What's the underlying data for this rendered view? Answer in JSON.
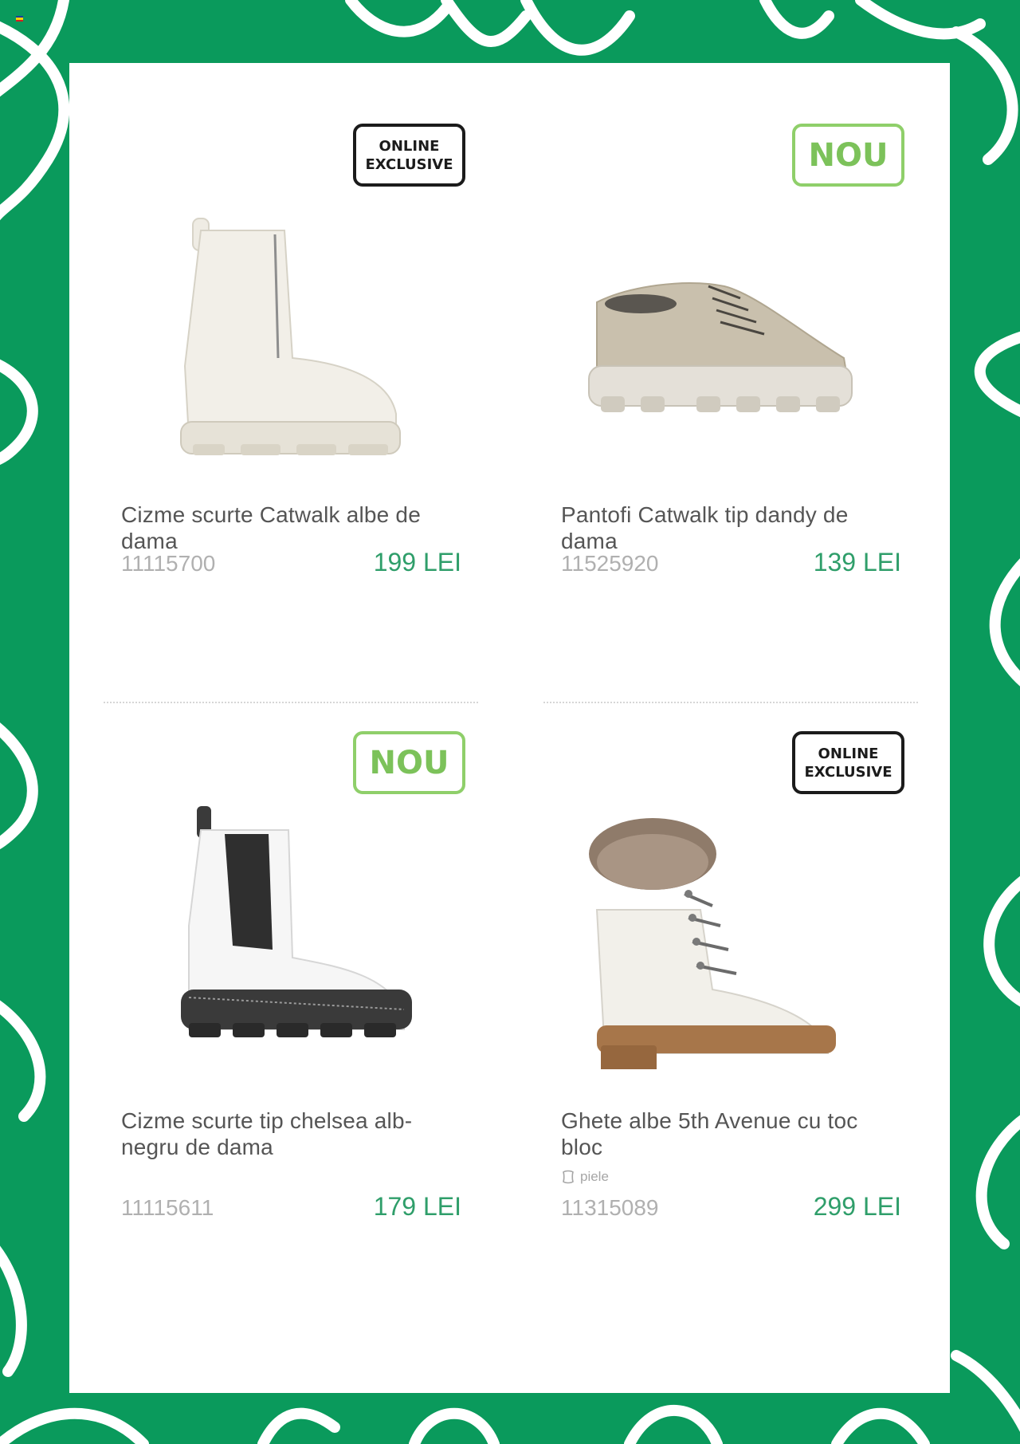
{
  "page": {
    "background_color": "#0a9a5c",
    "pattern_color": "#ffffff",
    "panel_color": "#ffffff"
  },
  "products": [
    {
      "badge": {
        "type": "online",
        "lines": [
          "ONLINE",
          "EXCLUSIVE"
        ]
      },
      "image": "white-zip-ankle-boot",
      "name": "Cizme scurte Catwalk albe de dama",
      "code": "11115700",
      "price": "199 LEI"
    },
    {
      "badge": {
        "type": "nou",
        "text": "NOU"
      },
      "image": "beige-lug-sole-derby-shoe",
      "name": "Pantofi Catwalk tip dandy de dama",
      "code": "11525920",
      "price": "139 LEI"
    },
    {
      "badge": {
        "type": "nou",
        "text": "NOU"
      },
      "image": "white-black-chelsea-boot",
      "name": "Cizme scurte tip chelsea alb-negru de dama",
      "code": "11115611",
      "price": "179 LEI"
    },
    {
      "badge": {
        "type": "online",
        "lines": [
          "ONLINE",
          "EXCLUSIVE"
        ]
      },
      "image": "white-fur-lace-up-block-heel-boot",
      "name": "Ghete albe 5th Avenue cu toc bloc",
      "material": {
        "icon": "leather-icon",
        "label": "piele"
      },
      "code": "11315089",
      "price": "299 LEI"
    }
  ]
}
